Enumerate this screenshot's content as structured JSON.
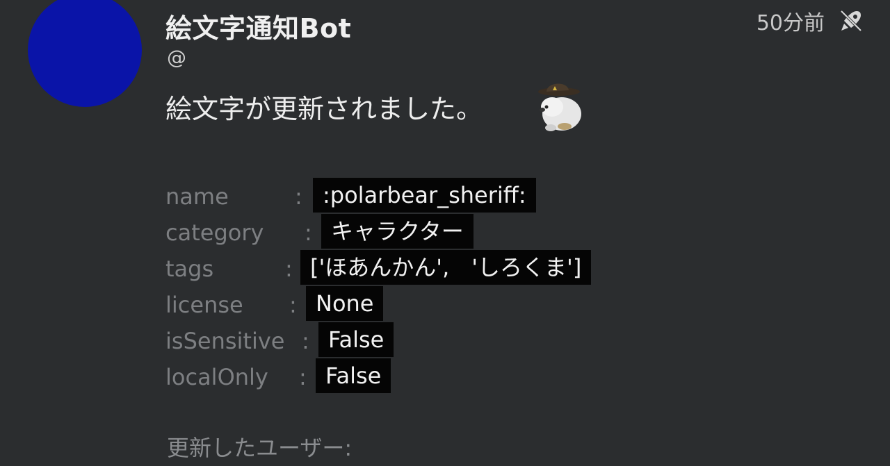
{
  "note": {
    "display_name": "絵文字通知Bot",
    "username": "@",
    "timestamp": "50分前",
    "visibility_icon": "rocket-off-icon",
    "message": "絵文字が更新されました。",
    "emoji_icon": "polarbear-sheriff-emoji",
    "avatar_color": "#0a14a8"
  },
  "fields": [
    {
      "key": "name",
      "colon": ":",
      "value": ":polarbear_sheriff:"
    },
    {
      "key": "category",
      "colon": ":",
      "value": "キャラクター"
    },
    {
      "key": "tags",
      "colon": ":",
      "value": "['ほあんかん',　'しろくま']"
    },
    {
      "key": "license",
      "colon": ":",
      "value": "None"
    },
    {
      "key": "isSensitive",
      "colon": ":",
      "value": "False"
    },
    {
      "key": "localOnly",
      "colon": ":",
      "value": "False"
    }
  ],
  "footer": {
    "label": "更新したユーザー:"
  }
}
